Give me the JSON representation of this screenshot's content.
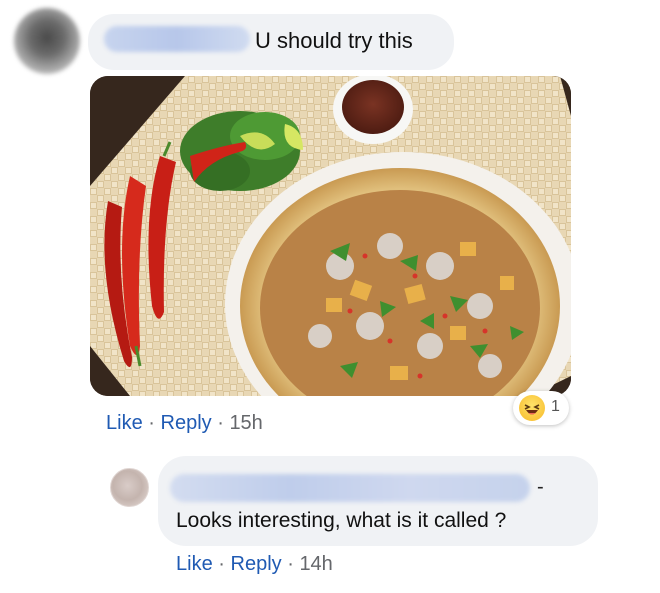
{
  "comments": [
    {
      "text": "U should try this",
      "actions": {
        "like": "Like",
        "reply": "Reply",
        "separator": "·",
        "time": "15h"
      },
      "reaction": {
        "emoji": "laughing-face",
        "count": "1"
      }
    },
    {
      "text": "Looks interesting, what is it called ?",
      "actions": {
        "like": "Like",
        "reply": "Reply",
        "separator": "·",
        "time": "14h"
      }
    }
  ],
  "reply_dash": "-",
  "colors": {
    "bubble": "#f0f2f5",
    "link": "#1f5ab3",
    "meta": "#65676b",
    "reaction_yellow": "#f7b928"
  }
}
